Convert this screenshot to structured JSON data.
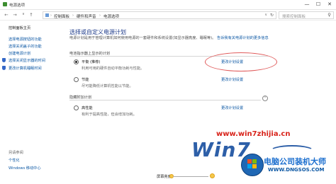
{
  "window": {
    "title": "电源选项",
    "minimize": "—",
    "maximize": "☐",
    "close": "✕"
  },
  "address_bar": {
    "back": "←",
    "forward": "→",
    "up": "↑",
    "crumbs": [
      "控制面板",
      "硬件和声音",
      "电源选项"
    ],
    "separator": "›",
    "dropdown": "∨",
    "refresh": "↻",
    "search_placeholder": "搜索控制面板"
  },
  "sidebar": {
    "items": [
      {
        "label": "控制面板主页",
        "link": false
      },
      {
        "label": "选择电源按钮的功能",
        "link": true
      },
      {
        "label": "选择关闭盖子的功能",
        "link": true
      },
      {
        "label": "创建电源计划",
        "link": true
      },
      {
        "label": "选择关闭显示器的时间",
        "link": true
      },
      {
        "label": "更改计算机睡眠时间",
        "link": true
      }
    ],
    "see_also": "另请参阅",
    "see_also_items": [
      "个性化",
      "Windows 移动中心"
    ]
  },
  "main": {
    "heading": "选择或自定义电源计划",
    "description": "电源计划是用于管理计算机如何使用电源的一套硬件和系统设置(如显示器亮度、睡眠等)。",
    "description_link": "告诉我有关电源计划的更多信息",
    "section_shown": "电池指示器上显示的计划",
    "section_hidden": "隐藏附加计划",
    "plans": [
      {
        "name": "平衡 (推荐)",
        "description": "利用可用的硬件自动平衡功耗与性能。",
        "change_link": "更改计划设置",
        "selected": true
      },
      {
        "name": "节能",
        "description": "尽可能降低计算机性能以节能。",
        "change_link": "更改计划设置",
        "selected": false
      },
      {
        "name": "高性能",
        "description": "有利于提高性能，但会增加功耗。",
        "change_link": "更改计划设置",
        "selected": false
      }
    ],
    "expand_glyph": "⌃"
  },
  "bottom": {
    "brightness_label": "屏幕亮度:"
  },
  "watermark": {
    "url": "www.win7zhijia.cn",
    "logo_text": "Win7",
    "site_name": "电脑公司装机大师",
    "site_url": "WWW.DNGSOS.COM"
  },
  "colors": {
    "link": "#0b57a4",
    "heading": "#1e3b8a",
    "highlight": "#e05a5a",
    "watermark_red": "#d8231a"
  }
}
